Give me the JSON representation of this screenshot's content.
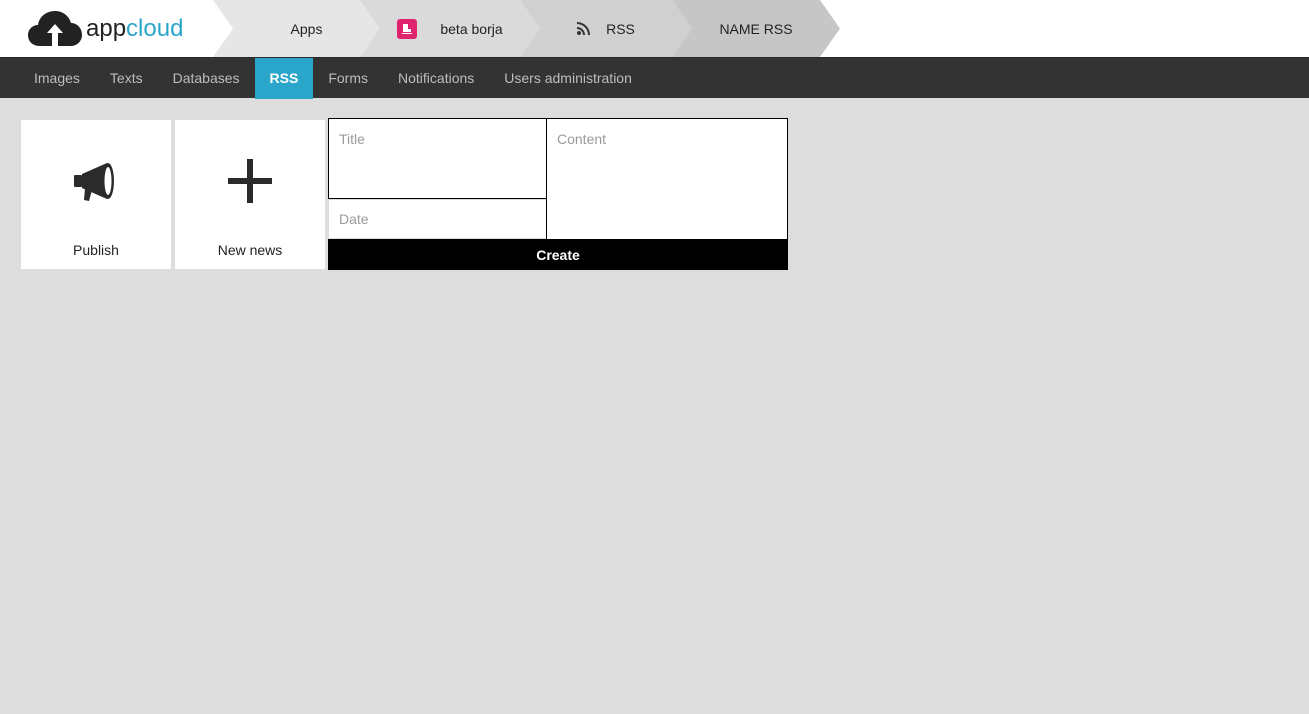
{
  "logo": {
    "part1": "app",
    "part2": "cloud",
    "icon": "cloud-upload-icon"
  },
  "breadcrumb": {
    "apps": "Apps",
    "app": {
      "label": "beta borja",
      "icon": "app-badge-icon",
      "badge_color": "#e0236f"
    },
    "rss": {
      "label": "RSS",
      "icon": "rss-icon"
    },
    "name": "NAME RSS"
  },
  "nav": {
    "items": [
      "Images",
      "Texts",
      "Databases",
      "RSS",
      "Forms",
      "Notifications",
      "Users administration"
    ],
    "active": "RSS",
    "accent": "#2ba6cb"
  },
  "tiles": {
    "publish": {
      "label": "Publish",
      "icon": "megaphone-icon"
    },
    "new_news": {
      "label": "New news",
      "icon": "plus-icon"
    }
  },
  "form": {
    "title_placeholder": "Title",
    "date_placeholder": "Date",
    "content_placeholder": "Content",
    "create_label": "Create"
  }
}
